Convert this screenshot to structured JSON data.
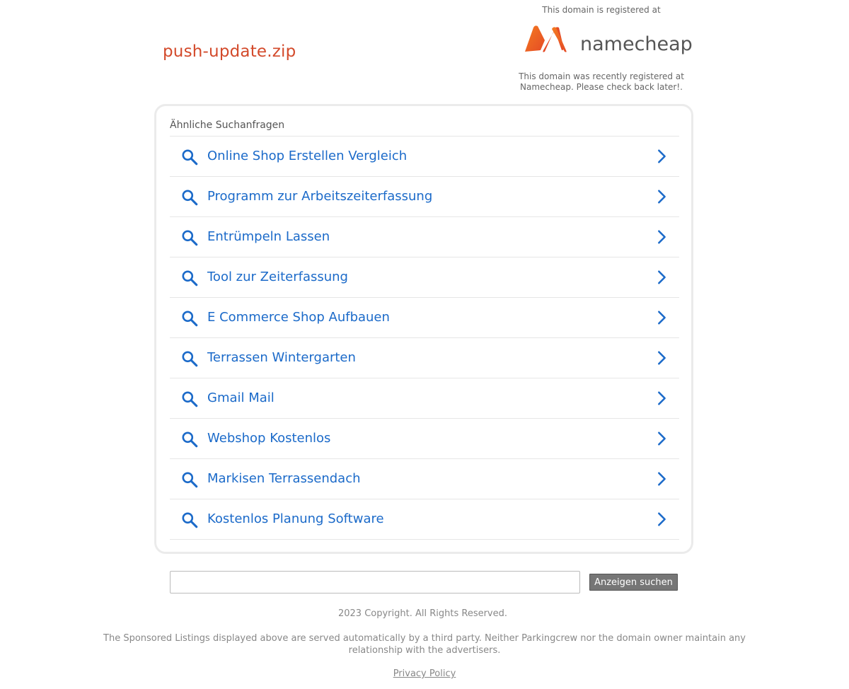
{
  "header": {
    "domain": "push-update.zip",
    "registrar_top": "This domain is registered at",
    "registrar_logo_text": "namecheap",
    "registrar_bottom": "This domain was recently registered at Namecheap. Please check back later!."
  },
  "related": {
    "title": "Ähnliche Suchanfragen",
    "items": [
      {
        "label": "Online Shop Erstellen Vergleich"
      },
      {
        "label": "Programm zur Arbeitszeiterfassung"
      },
      {
        "label": "Entrümpeln Lassen"
      },
      {
        "label": "Tool zur Zeiterfassung"
      },
      {
        "label": "E Commerce Shop Aufbauen"
      },
      {
        "label": "Terrassen Wintergarten"
      },
      {
        "label": "Gmail Mail"
      },
      {
        "label": "Webshop Kostenlos"
      },
      {
        "label": "Markisen Terrassendach"
      },
      {
        "label": "Kostenlos Planung Software"
      }
    ]
  },
  "search": {
    "value": "",
    "button_label": "Anzeigen suchen"
  },
  "footer": {
    "copyright": "2023 Copyright. All Rights Reserved.",
    "disclaimer": "The Sponsored Listings displayed above are served automatically by a third party. Neither Parkingcrew nor the domain owner maintain any relationship with the advertisers.",
    "privacy_link": "Privacy Policy"
  },
  "colors": {
    "domain_title": "#d34a2b",
    "link_blue": "#1b6ac9",
    "logo_orange": "#f15a22",
    "logo_gray": "#555555"
  },
  "icons": {
    "list_leading": "search-icon",
    "list_trailing": "chevron-right-icon"
  }
}
